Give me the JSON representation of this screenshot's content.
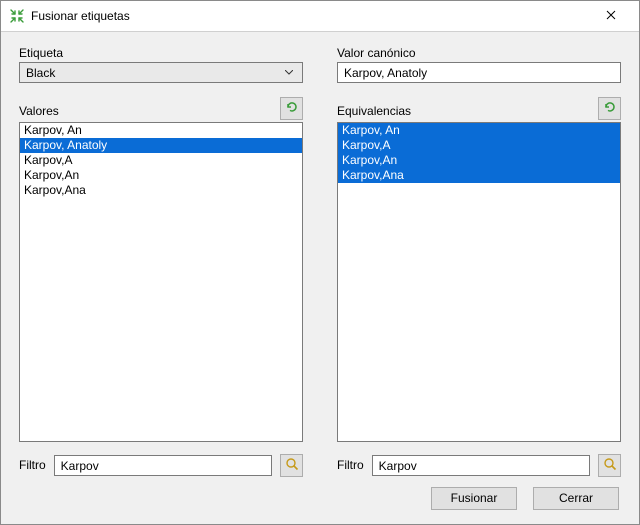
{
  "window": {
    "title": "Fusionar etiquetas"
  },
  "left": {
    "tag_label": "Etiqueta",
    "tag_value": "Black",
    "values_label": "Valores",
    "values": [
      "Karpov, An",
      "Karpov, Anatoly",
      "Karpov,A",
      "Karpov,An",
      "Karpov,Ana"
    ],
    "selected_index": 1,
    "filter_label": "Filtro",
    "filter_value": "Karpov"
  },
  "right": {
    "canonical_label": "Valor canónico",
    "canonical_value": "Karpov, Anatoly",
    "equiv_label": "Equivalencias",
    "equivalences": [
      "Karpov, An",
      "Karpov,A",
      "Karpov,An",
      "Karpov,Ana"
    ],
    "all_selected": true,
    "filter_label": "Filtro",
    "filter_value": "Karpov"
  },
  "buttons": {
    "merge": "Fusionar",
    "close": "Cerrar"
  }
}
